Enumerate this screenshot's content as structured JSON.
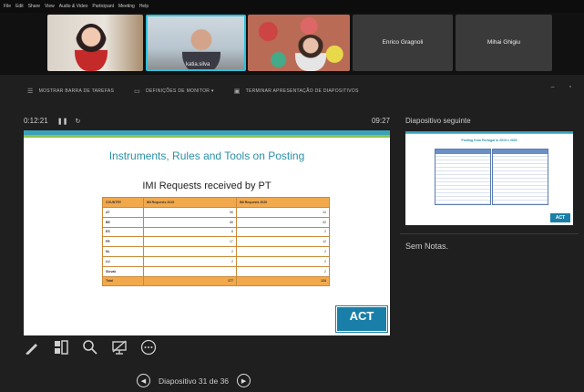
{
  "menu": [
    "File",
    "Edit",
    "Share",
    "View",
    "Audio & Video",
    "Participant",
    "Meeting",
    "Help"
  ],
  "participants": [
    {
      "name": ""
    },
    {
      "name": "katia.silva"
    },
    {
      "name": ""
    },
    {
      "name": "Enrico Gragnoli"
    },
    {
      "name": "Mihai Ghigiu"
    }
  ],
  "toolbar": {
    "taskbar": "MOSTRAR BARRA DE TAREFAS",
    "monitor": "DEFINIÇÕES DE MONITOR ▾",
    "end": "TERMINAR APRESENTAÇÃO DE DIAPOSITIVOS"
  },
  "timer": {
    "elapsed": "0:12:21",
    "clock": "09:27"
  },
  "slide": {
    "title": "Instruments, Rules and Tools on Posting",
    "subtitle": "IMI Requests received by PT",
    "table": {
      "headers": [
        "COUNTRY",
        "IMI Requests 2019",
        "IMI Requests 2020"
      ],
      "rows": [
        [
          "AT",
          "56",
          "24"
        ],
        [
          "BE",
          "88",
          "92"
        ],
        [
          "ES",
          "8",
          "2"
        ],
        [
          "FR",
          "17",
          "12"
        ],
        [
          "NL",
          "2",
          "2"
        ],
        [
          "LU",
          "2",
          "2"
        ],
        [
          "Slovak",
          "",
          "2"
        ]
      ],
      "total": [
        "Total",
        "177",
        "124"
      ]
    },
    "logo": "ACT"
  },
  "next": {
    "label": "Diapositivo seguinte",
    "thumb_title": "Posting from Portugal in 2019 e 2020",
    "thumb_logo": "ACT"
  },
  "notes": "Sem Notas.",
  "icons": [
    "pen-icon",
    "grid-icon",
    "magnifier-icon",
    "screen-off-icon",
    "more-icon"
  ],
  "nav": {
    "label": "Diapositivo 31 de 36"
  },
  "colors": {
    "accent": "#2fc0d8",
    "slide_title": "#2a8fa8",
    "table_head": "#f2a94c",
    "logo": "#1a7fa8"
  }
}
